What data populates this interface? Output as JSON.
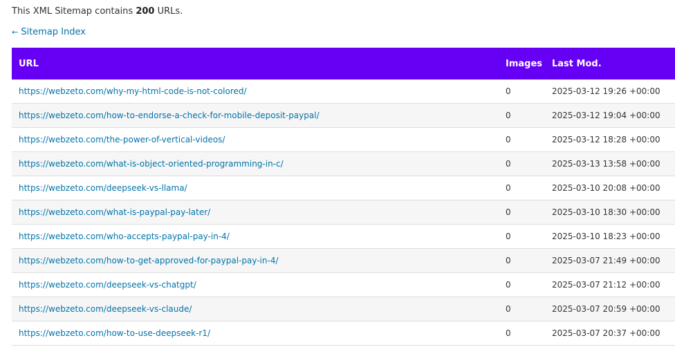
{
  "intro": {
    "prefix": "This XML Sitemap contains",
    "count": "200",
    "suffix": "URLs."
  },
  "back_link": {
    "arrow": "←",
    "label": "Sitemap Index"
  },
  "table": {
    "headers": {
      "url": "URL",
      "images": "Images",
      "last_mod": "Last Mod."
    },
    "rows": [
      {
        "url": "https://webzeto.com/why-my-html-code-is-not-colored/",
        "images": "0",
        "last_mod": "2025-03-12 19:26 +00:00"
      },
      {
        "url": "https://webzeto.com/how-to-endorse-a-check-for-mobile-deposit-paypal/",
        "images": "0",
        "last_mod": "2025-03-12 19:04 +00:00"
      },
      {
        "url": "https://webzeto.com/the-power-of-vertical-videos/",
        "images": "0",
        "last_mod": "2025-03-12 18:28 +00:00"
      },
      {
        "url": "https://webzeto.com/what-is-object-oriented-programming-in-c/",
        "images": "0",
        "last_mod": "2025-03-13 13:58 +00:00"
      },
      {
        "url": "https://webzeto.com/deepseek-vs-llama/",
        "images": "0",
        "last_mod": "2025-03-10 20:08 +00:00"
      },
      {
        "url": "https://webzeto.com/what-is-paypal-pay-later/",
        "images": "0",
        "last_mod": "2025-03-10 18:30 +00:00"
      },
      {
        "url": "https://webzeto.com/who-accepts-paypal-pay-in-4/",
        "images": "0",
        "last_mod": "2025-03-10 18:23 +00:00"
      },
      {
        "url": "https://webzeto.com/how-to-get-approved-for-paypal-pay-in-4/",
        "images": "0",
        "last_mod": "2025-03-07 21:49 +00:00"
      },
      {
        "url": "https://webzeto.com/deepseek-vs-chatgpt/",
        "images": "0",
        "last_mod": "2025-03-07 21:12 +00:00"
      },
      {
        "url": "https://webzeto.com/deepseek-vs-claude/",
        "images": "0",
        "last_mod": "2025-03-07 20:59 +00:00"
      },
      {
        "url": "https://webzeto.com/how-to-use-deepseek-r1/",
        "images": "0",
        "last_mod": "2025-03-07 20:37 +00:00"
      }
    ]
  },
  "colors": {
    "header_bg": "#6500f4",
    "link": "#0073aa"
  }
}
